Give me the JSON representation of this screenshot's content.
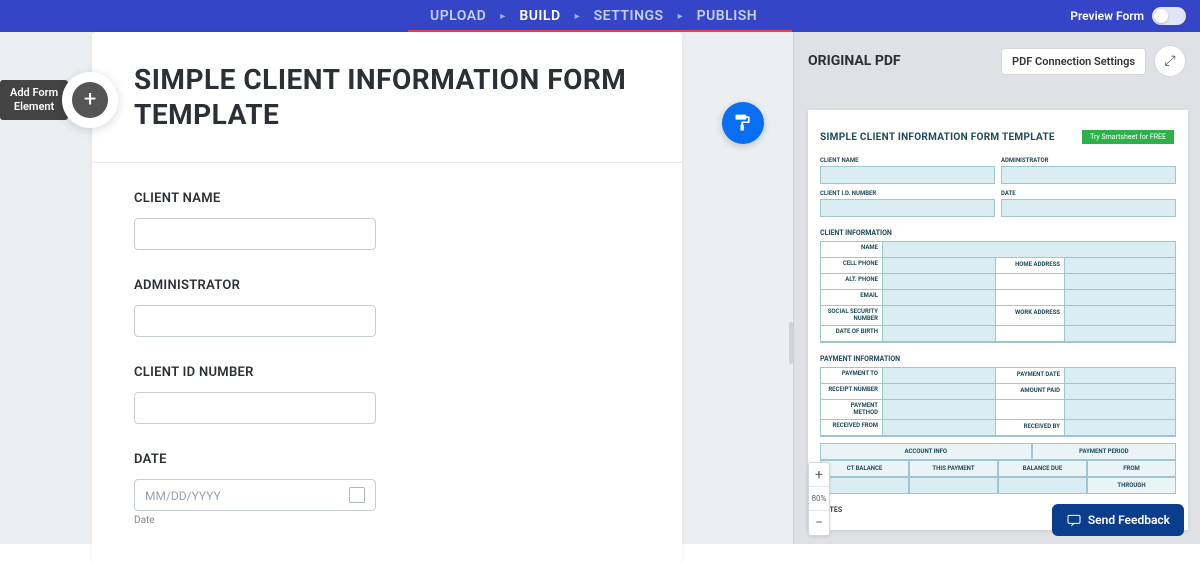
{
  "nav": {
    "steps": [
      "UPLOAD",
      "BUILD",
      "SETTINGS",
      "PUBLISH"
    ],
    "active": "BUILD",
    "preview_label": "Preview Form"
  },
  "add_element": {
    "line1": "Add Form",
    "line2": "Element"
  },
  "form": {
    "title": "SIMPLE CLIENT INFORMATION FORM TEMPLATE",
    "fields": [
      {
        "label": "CLIENT NAME",
        "type": "text"
      },
      {
        "label": "ADMINISTRATOR",
        "type": "text"
      },
      {
        "label": "CLIENT ID NUMBER",
        "type": "text"
      },
      {
        "label": "DATE",
        "type": "date",
        "placeholder": "MM/DD/YYYY",
        "sublabel": "Date"
      }
    ]
  },
  "pdf_panel": {
    "title": "ORIGINAL PDF",
    "settings_btn": "PDF Connection Settings",
    "doc_title": "SIMPLE CLIENT INFORMATION FORM TEMPLATE",
    "try_badge": "Try Smartsheet for FREE",
    "top_cells": [
      "CLIENT NAME",
      "ADMINISTRATOR",
      "CLIENT I.D. NUMBER",
      "DATE"
    ],
    "section1": "CLIENT INFORMATION",
    "info_rows": [
      {
        "l": "NAME",
        "r": ""
      },
      {
        "l": "CELL PHONE",
        "r": "HOME ADDRESS"
      },
      {
        "l": "ALT. PHONE",
        "r": ""
      },
      {
        "l": "EMAIL",
        "r": ""
      },
      {
        "l": "SOCIAL SECURITY NUMBER",
        "r": "WORK ADDRESS"
      },
      {
        "l": "DATE OF BIRTH",
        "r": ""
      }
    ],
    "section2": "PAYMENT INFORMATION",
    "pay_rows": [
      {
        "l": "PAYMENT TO",
        "r": "PAYMENT DATE"
      },
      {
        "l": "RECEIPT NUMBER",
        "r": "AMOUNT PAID"
      },
      {
        "l": "PAYMENT METHOD",
        "r": ""
      },
      {
        "l": "RECEIVED FROM",
        "r": "RECEIVED BY"
      }
    ],
    "grid_head1": [
      "ACCOUNT INFO",
      "PAYMENT PERIOD"
    ],
    "grid_head2": [
      "CT BALANCE",
      "THIS PAYMENT",
      "BALANCE DUE",
      "FROM"
    ],
    "grid_head3": [
      "",
      "",
      "",
      "THROUGH"
    ],
    "section3": "NOTES",
    "zoom": "80%"
  },
  "feedback": "Send Feedback"
}
